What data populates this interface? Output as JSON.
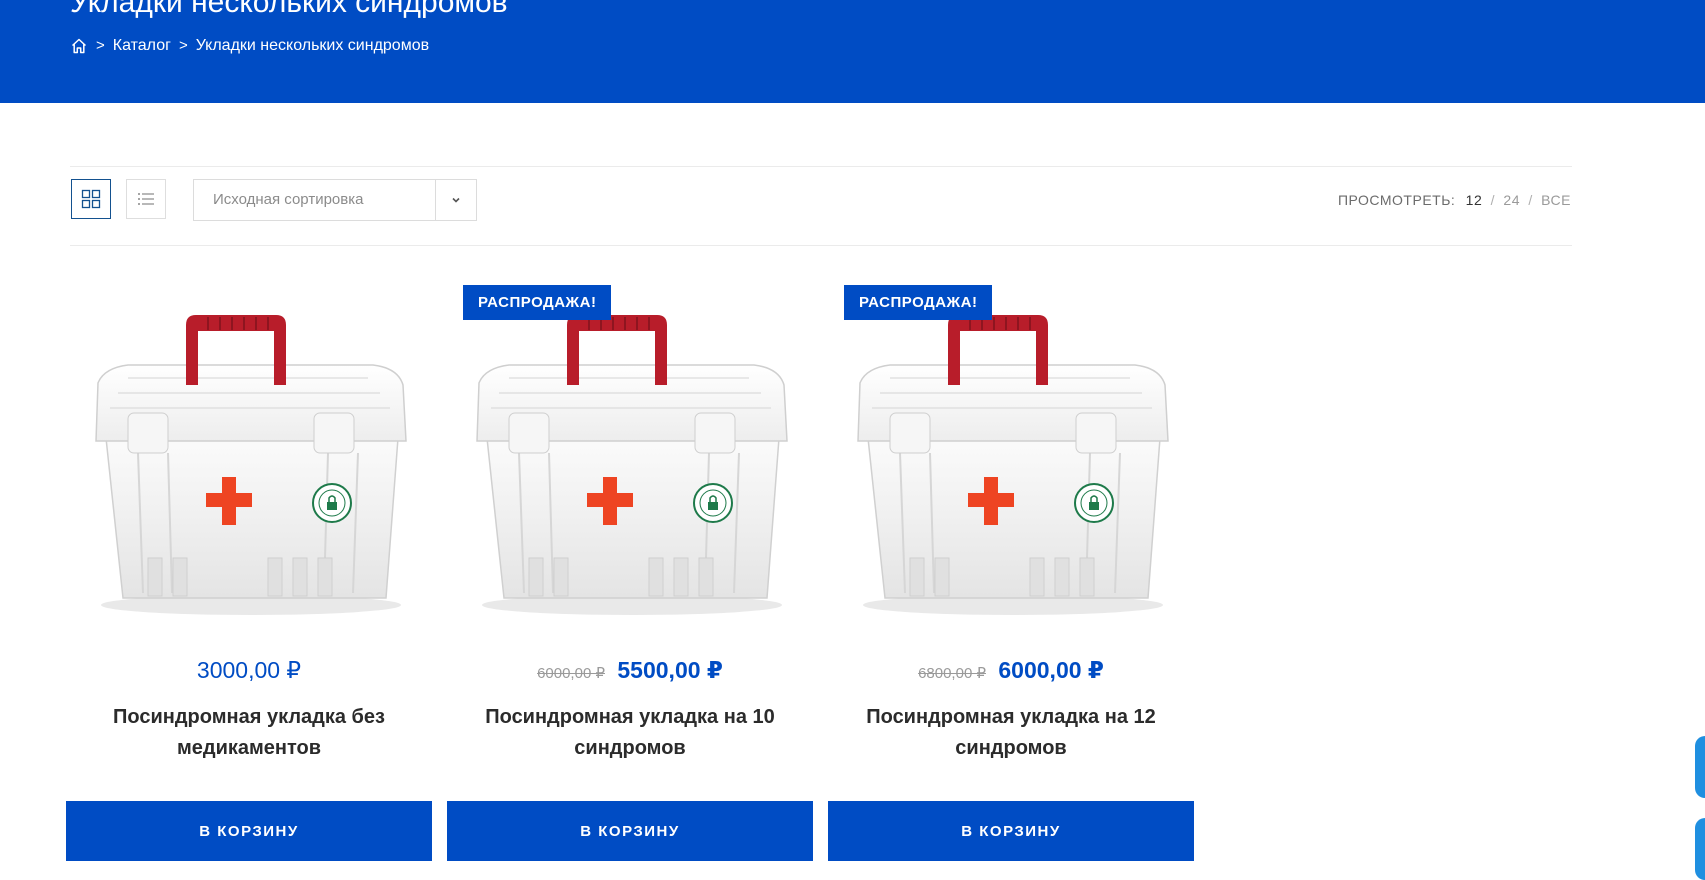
{
  "header": {
    "title": "Укладки нескольких синдромов",
    "breadcrumb": {
      "home_icon": "home-icon",
      "separator": ">",
      "catalog": "Каталог",
      "current": "Укладки нескольких синдромов"
    }
  },
  "toolbar": {
    "grid_icon": "grid-view-icon",
    "list_icon": "list-view-icon",
    "sort_label": "Исходная сортировка",
    "sort_arrow_icon": "chevron-down-icon",
    "per_page_label": "ПРОСМОТРЕТЬ:",
    "per_page_options": [
      "12",
      "24",
      "ВСЕ"
    ],
    "per_page_current": "12",
    "slash": "/"
  },
  "products": [
    {
      "badge": "",
      "old_price": "",
      "price": "3000,00 ₽",
      "title": "Посиндромная укладка без медикаментов",
      "cart": "В КОРЗИНУ"
    },
    {
      "badge": "РАСПРОДАЖА!",
      "old_price": "6000,00 ₽",
      "price": "5500,00 ₽",
      "title": "Посиндромная укладка на 10 синдромов",
      "cart": "В КОРЗИНУ"
    },
    {
      "badge": "РАСПРОДАЖА!",
      "old_price": "6800,00 ₽",
      "price": "6000,00 ₽",
      "title": "Посиндромная укладка на 12 синдромов",
      "cart": "В КОРЗИНУ"
    }
  ],
  "colors": {
    "brand": "#004cc4",
    "handle": "#b81d2a",
    "cross": "#ee4422",
    "seal": "#1e7a4a"
  }
}
